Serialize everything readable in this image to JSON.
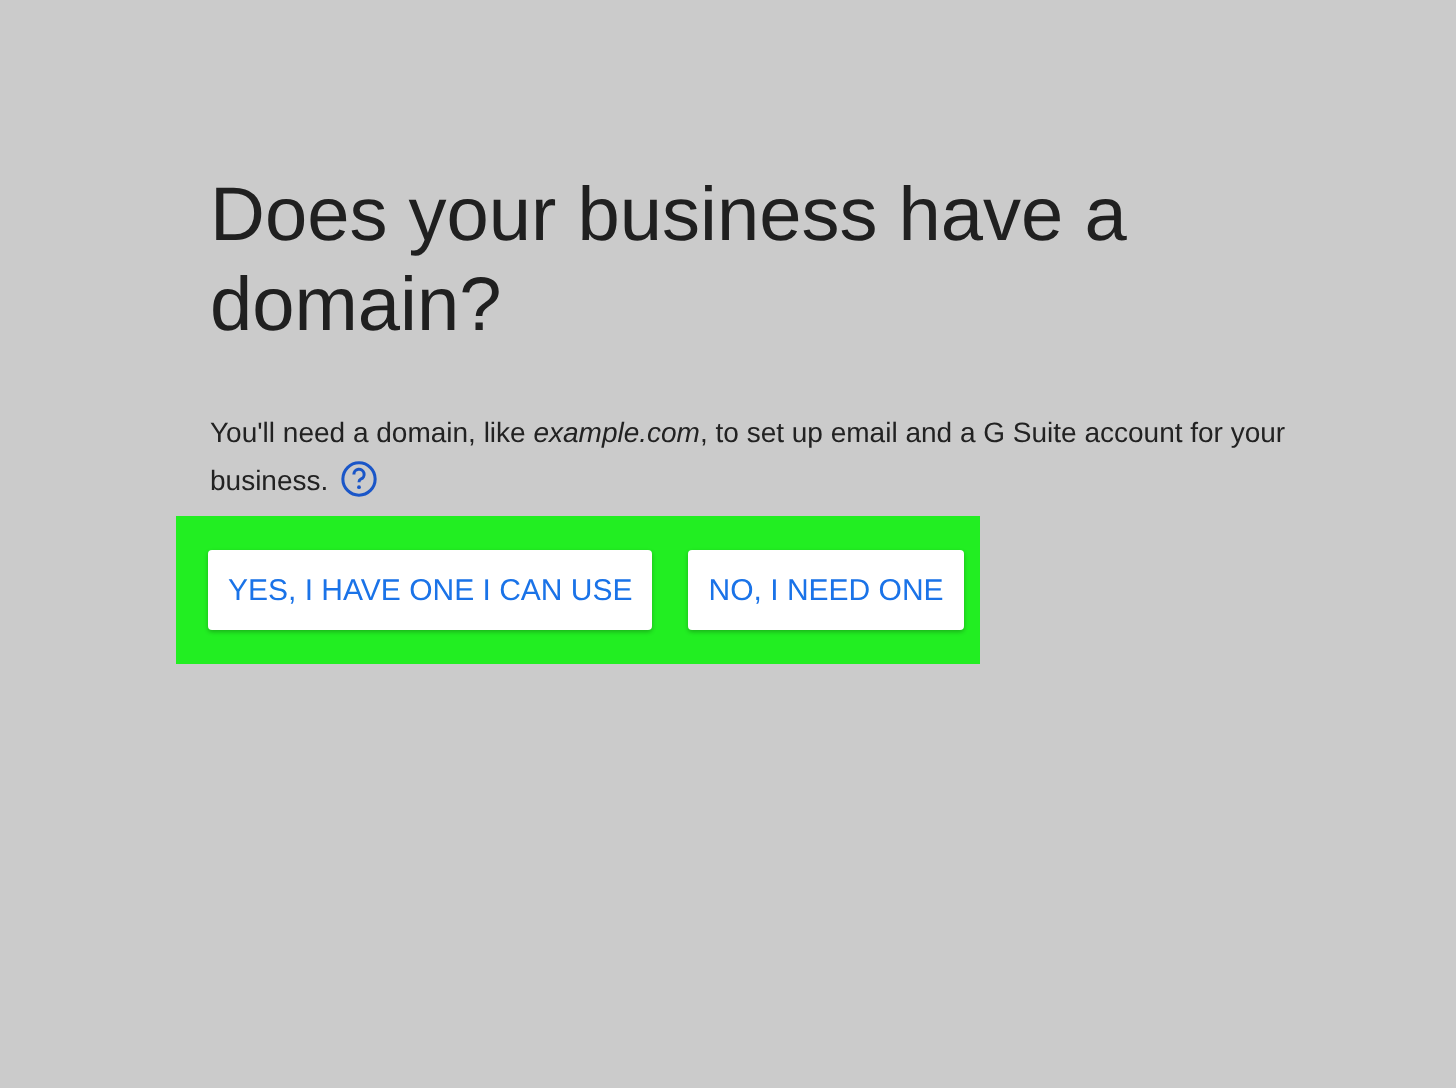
{
  "heading": "Does your business have a domain?",
  "description": "You'll need a domain, like *example.com*, to set up email and a G Suite account for your business.",
  "buttons": [
    {
      "label": "YES, I HAVE ONE I CAN USE"
    },
    {
      "label": "NO, I NEED ONE"
    }
  ]
}
